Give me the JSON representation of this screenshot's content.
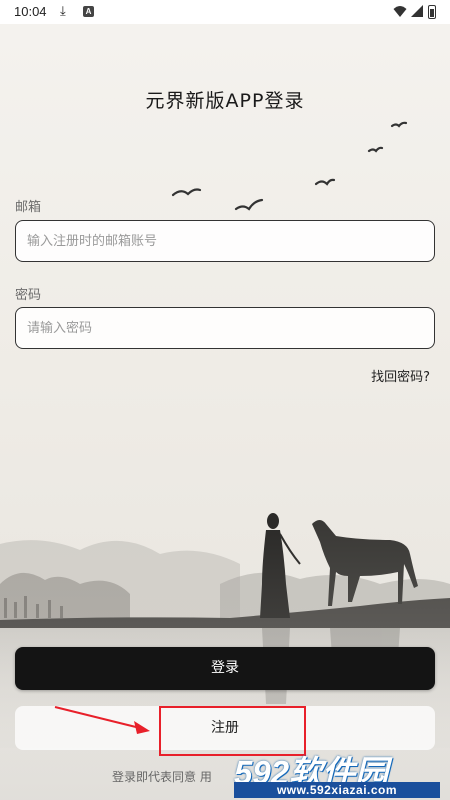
{
  "status_bar": {
    "time": "10:04",
    "icons": [
      "download-icon",
      "a-notification-icon",
      "wifi-icon",
      "signal-icon",
      "battery-icon"
    ]
  },
  "login": {
    "title": "元界新版APP登录",
    "email_label": "邮箱",
    "email_placeholder": "输入注册时的邮箱账号",
    "password_label": "密码",
    "password_placeholder": "请输入密码",
    "forgot_password": "找回密码?",
    "login_button": "登录",
    "register_button": "注册",
    "agreement_text": "登录即代表同意 用"
  },
  "watermark": {
    "brand": "592软件园",
    "url": "www.592xiazai.com"
  },
  "colors": {
    "primary_button": "#141414",
    "annotation": "#e8202a",
    "watermark_blue": "#1a4f9c"
  }
}
